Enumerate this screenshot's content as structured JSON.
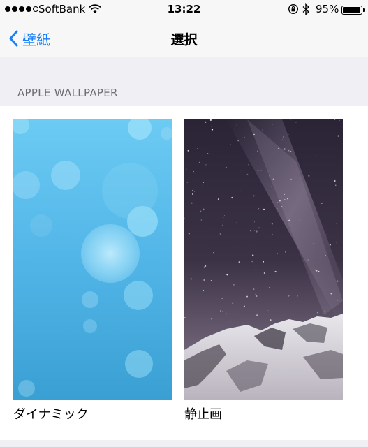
{
  "status_bar": {
    "carrier": "SoftBank",
    "time": "13:22",
    "battery_percent": "95%",
    "battery_level": 0.95,
    "signal_bars": [
      true,
      true,
      true,
      true,
      false
    ],
    "icons": [
      "wifi-icon",
      "orientation-lock-icon",
      "bluetooth-icon",
      "battery-icon"
    ]
  },
  "nav": {
    "back_label": "壁紙",
    "title": "選択"
  },
  "section": {
    "header": "APPLE WALLPAPER"
  },
  "wallpapers": [
    {
      "label": "ダイナミック",
      "style": "blue-bokeh",
      "colors": [
        "#6ccbf3",
        "#3a9fd2"
      ]
    },
    {
      "label": "静止画",
      "style": "night-sky-mountain",
      "colors": [
        "#2a2436",
        "#6b5f73"
      ]
    }
  ],
  "colors": {
    "accent": "#147efb",
    "background": "#efeff4",
    "section_text": "#6d6d72"
  }
}
